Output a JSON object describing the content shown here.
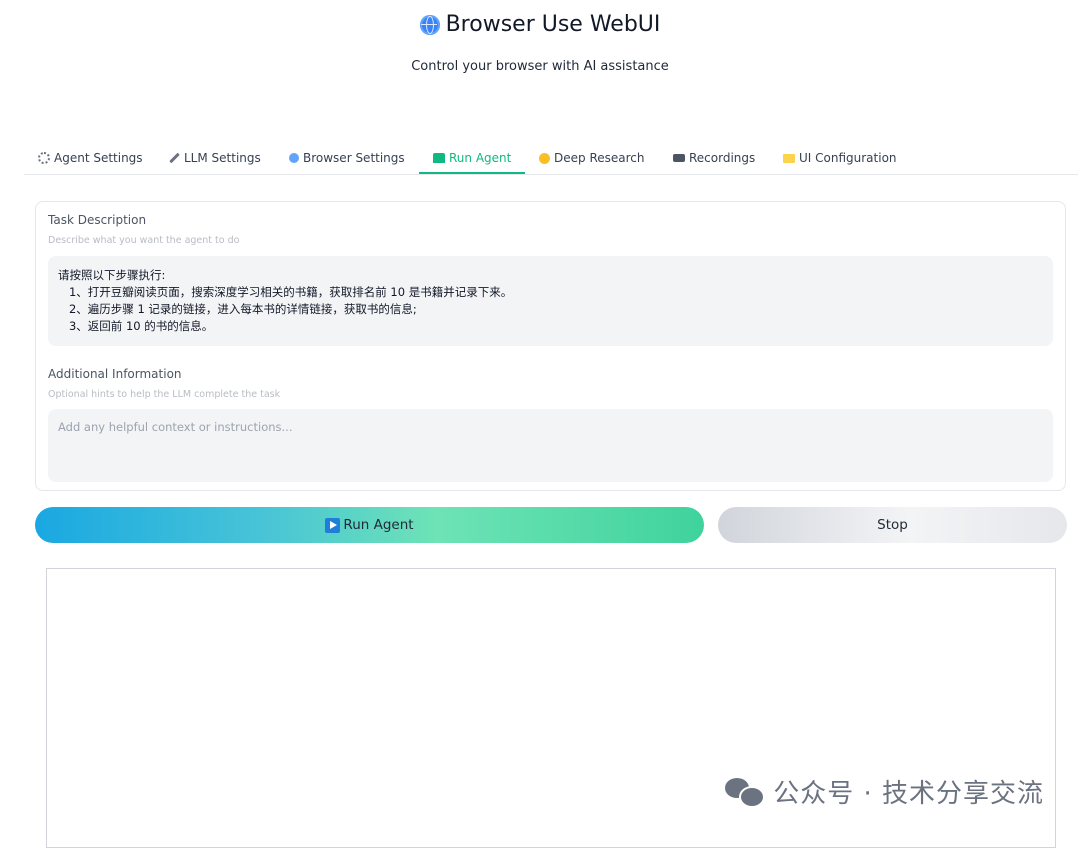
{
  "header": {
    "title": "Browser Use WebUI",
    "title_icon": "globe-icon",
    "subtitle": "Control your browser with AI assistance"
  },
  "tabs": [
    {
      "label": "Agent Settings",
      "icon": "gear-icon"
    },
    {
      "label": "LLM Settings",
      "icon": "wrench-icon"
    },
    {
      "label": "Browser Settings",
      "icon": "globe-icon"
    },
    {
      "label": "Run Agent",
      "icon": "robot-icon",
      "active": true
    },
    {
      "label": "Deep Research",
      "icon": "thinking-face-icon"
    },
    {
      "label": "Recordings",
      "icon": "camera-icon"
    },
    {
      "label": "UI Configuration",
      "icon": "folder-icon"
    }
  ],
  "task": {
    "label": "Task Description",
    "hint": "Describe what you want the agent to do",
    "lines": [
      "请按照以下步骤执行:",
      "   1、打开豆瓣阅读页面，搜索深度学习相关的书籍，获取排名前 10 是书籍并记录下来。",
      "   2、遍历步骤 1 记录的链接，进入每本书的详情链接，获取书的信息;",
      "   3、返回前 10 的书的信息。"
    ]
  },
  "additional": {
    "label": "Additional Information",
    "hint": "Optional hints to help the LLM complete the task",
    "placeholder": "Add any helpful context or instructions..."
  },
  "buttons": {
    "run_label": "Run Agent",
    "stop_label": "Stop"
  },
  "watermark": "公众号 · 技术分享交流"
}
